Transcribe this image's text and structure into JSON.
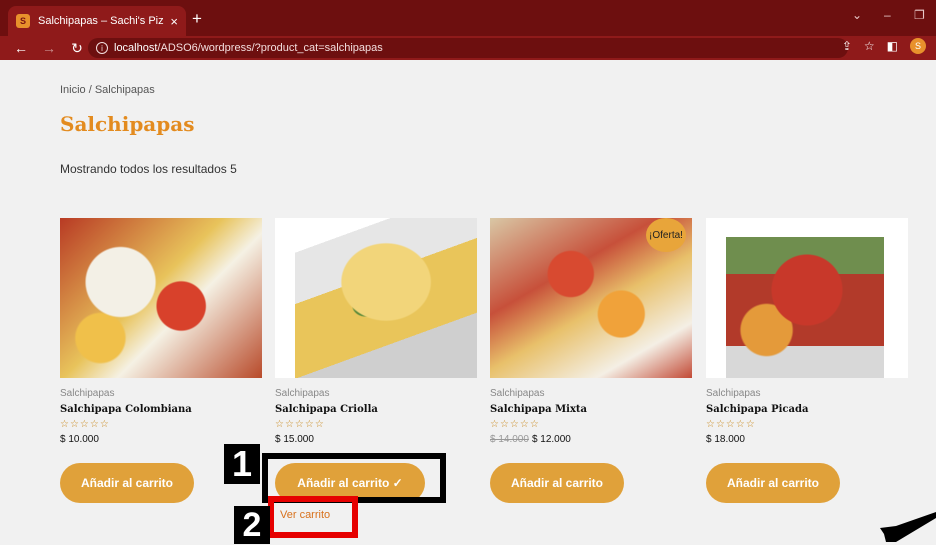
{
  "browser": {
    "tab_title": "Salchipapas – Sachi's Pizza",
    "favicon_letter": "S",
    "tab_close": "×",
    "new_tab": "+",
    "url_host": "localhost",
    "url_path": "/ADSO6/wordpress/?product_cat=salchipapas",
    "profile_initial": "S"
  },
  "page": {
    "breadcrumb": "Inicio / Salchipapas",
    "title": "Salchipapas",
    "result_count": "Mostrando todos los resultados 5"
  },
  "products": [
    {
      "category": "Salchipapas",
      "name": "Salchipapa Colombiana",
      "stars": "☆☆☆☆☆",
      "price": "$ 10.000",
      "button": "Añadir al carrito"
    },
    {
      "category": "Salchipapas",
      "name": "Salchipapa Criolla",
      "stars": "☆☆☆☆☆",
      "price": "$ 15.000",
      "button": "Añadir al carrito ✓",
      "view_cart": "Ver carrito"
    },
    {
      "category": "Salchipapas",
      "name": "Salchipapa Mixta",
      "stars": "☆☆☆☆☆",
      "price_old": "$ 14.000",
      "price": "$ 12.000",
      "badge": "¡Oferta!",
      "button": "Añadir al carrito"
    },
    {
      "category": "Salchipapas",
      "name": "Salchipapa Picada",
      "stars": "☆☆☆☆☆",
      "price": "$ 18.000",
      "button": "Añadir al carrito"
    }
  ],
  "annotations": {
    "label1": "1",
    "label2": "2"
  },
  "colors": {
    "browser": "#7a1212",
    "accent": "#e38b1f",
    "button": "#e0a13a",
    "box1": "#000000",
    "box2": "#e60000"
  }
}
